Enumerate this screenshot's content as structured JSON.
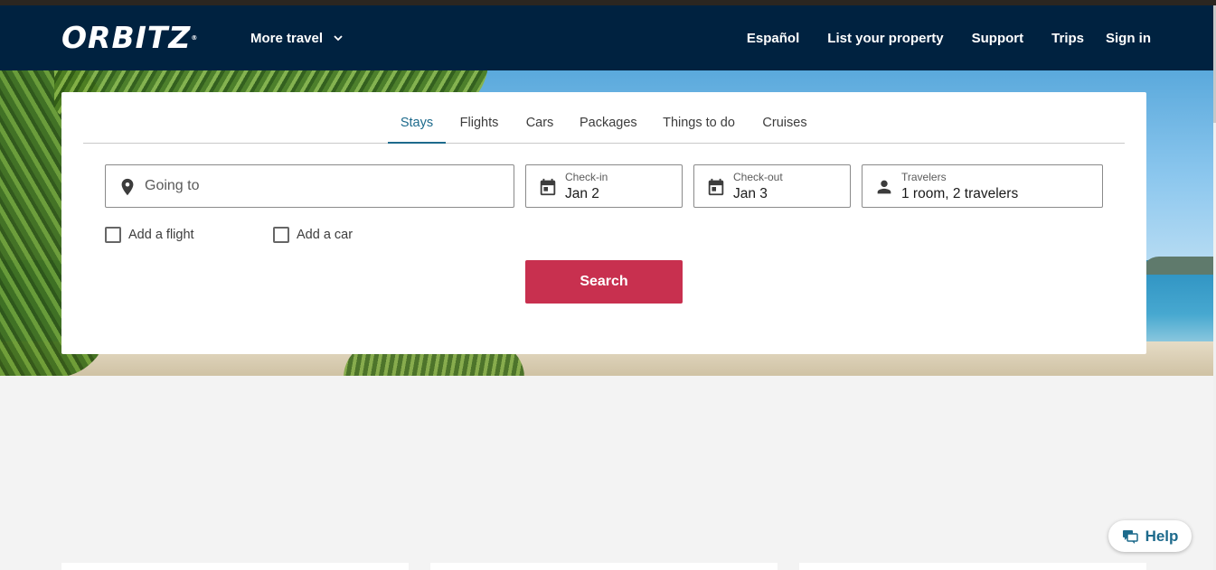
{
  "header": {
    "logo_text": "ORBITZ",
    "logo_tm": "®",
    "more_travel_label": "More travel",
    "links": [
      "Español",
      "List your property",
      "Support",
      "Trips",
      "Sign in"
    ]
  },
  "search_form": {
    "tabs": [
      "Stays",
      "Flights",
      "Cars",
      "Packages",
      "Things to do",
      "Cruises"
    ],
    "active_tab": "Stays",
    "going_to_placeholder": "Going to",
    "checkin": {
      "label": "Check-in",
      "value": "Jan 2"
    },
    "checkout": {
      "label": "Check-out",
      "value": "Jan 3"
    },
    "travelers": {
      "label": "Travelers",
      "value": "1 room, 2 travelers"
    },
    "add_flight_label": "Add a flight",
    "add_car_label": "Add a car",
    "search_button_label": "Search"
  },
  "help": {
    "label": "Help"
  },
  "colors": {
    "nav_background": "#002240",
    "accent": "#1d6a8c",
    "search_button": "#c8304f",
    "page_background": "#f3f3f3"
  },
  "icons": {
    "location": "location-pin-icon",
    "calendar": "calendar-icon",
    "person": "person-icon",
    "chevron": "chevron-down-icon",
    "help": "chat-bubble-icon"
  }
}
